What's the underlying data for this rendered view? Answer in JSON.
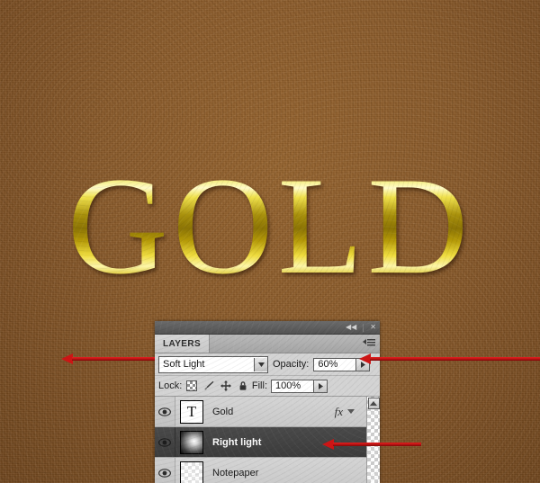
{
  "canvas": {
    "background_color": "#8a5a29",
    "artwork_text": "GOLD",
    "artwork_style": "gold-gradient-serif"
  },
  "panel": {
    "titlebar": {
      "collapse_icon": "◀◀",
      "close_icon": "✕"
    },
    "tabs": [
      {
        "label": "LAYERS",
        "active": true
      }
    ],
    "menu_icon": "panel-menu-icon",
    "blend_row": {
      "blend_mode": "Soft Light",
      "opacity_label": "Opacity:",
      "opacity_value": "60%"
    },
    "lock_row": {
      "lock_label": "Lock:",
      "lock_icons": [
        "transparent-pixels-icon",
        "paintbrush-icon",
        "move-icon",
        "lock-all-icon"
      ],
      "fill_label": "Fill:",
      "fill_value": "100%"
    },
    "layers": [
      {
        "name": "Gold",
        "visible": true,
        "selected": false,
        "thumb_type": "text",
        "thumb_glyph": "T",
        "has_fx": true,
        "fx_label": "fx"
      },
      {
        "name": "Right light",
        "visible": true,
        "selected": true,
        "thumb_type": "gradient",
        "thumb_glyph": "",
        "has_fx": false,
        "fx_label": ""
      },
      {
        "name": "Notepaper",
        "visible": true,
        "selected": false,
        "thumb_type": "blank",
        "thumb_glyph": "",
        "has_fx": false,
        "fx_label": ""
      }
    ]
  },
  "annotations": {
    "arrow_color": "#cc1515",
    "arrows": [
      {
        "name": "arrow-to-blend-mode",
        "target": "Soft Light dropdown"
      },
      {
        "name": "arrow-to-opacity",
        "target": "Opacity field"
      },
      {
        "name": "arrow-to-right-light-layer",
        "target": "Right light layer row"
      }
    ]
  }
}
